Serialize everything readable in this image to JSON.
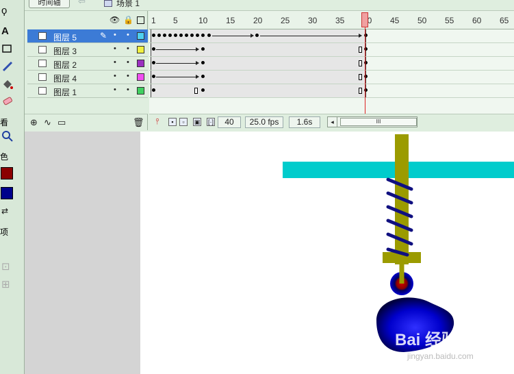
{
  "tools": {
    "label_view": "看",
    "label_color": "色",
    "label_options": "项",
    "stroke_color": "#8b0000",
    "fill_color": "#00008b"
  },
  "timeline": {
    "tab_label": "时间轴",
    "scene_label": "场景 1",
    "ruler_numbers": [
      "1",
      "5",
      "10",
      "15",
      "20",
      "25",
      "30",
      "35",
      "40",
      "45",
      "50",
      "55",
      "60",
      "65"
    ],
    "layers": [
      {
        "name": "图层 5",
        "color": "#4fd0f0",
        "selected": true
      },
      {
        "name": "图层 3",
        "color": "#f0f040",
        "selected": false
      },
      {
        "name": "图层 2",
        "color": "#9b30c0",
        "selected": false
      },
      {
        "name": "图层 4",
        "color": "#f050f0",
        "selected": false
      },
      {
        "name": "图层 1",
        "color": "#40d060",
        "selected": false
      }
    ],
    "current_frame": "40",
    "frame_rate": "25.0 fps",
    "elapsed_time": "1.6s",
    "scroll_grip": "III"
  },
  "stage": {
    "bar_color": "#00cccc",
    "rod_color": "#9b9b00",
    "spring_color": "#101080",
    "ball_color": "#0000cc",
    "watermark_main": "Bai 经验",
    "watermark_sub": "jingyan.baidu.com"
  }
}
